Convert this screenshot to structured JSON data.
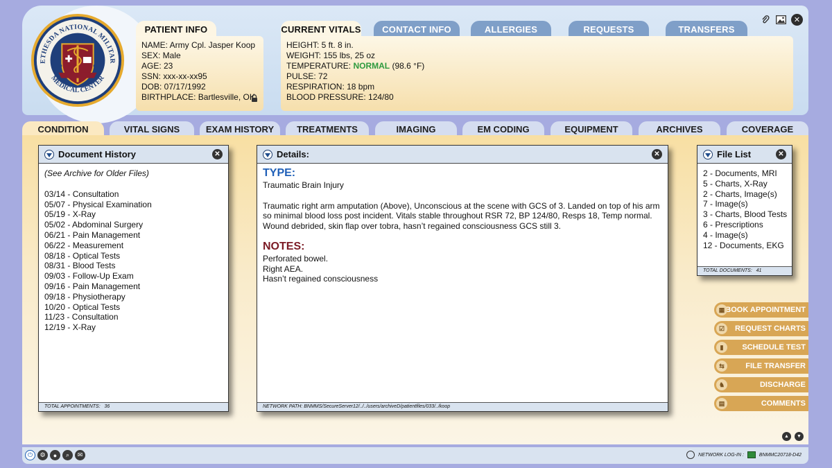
{
  "logo": {
    "text_top": "BETHESDA NATIONAL MILITARY",
    "text_bottom": "MEDICAL CENTER"
  },
  "window_icons": [
    "paperclip-icon",
    "image-icon",
    "close-icon"
  ],
  "header_tabs": {
    "patient_info": "PATIENT INFO",
    "current_vitals": "CURRENT VITALS",
    "contact_info": "CONTACT INFO",
    "allergies": "ALLERGIES",
    "requests": "REQUESTS",
    "transfers": "TRANSFERS"
  },
  "patient": {
    "name": "NAME: Army Cpl. Jasper Koop",
    "sex": "SEX: Male",
    "age": "AGE: 23",
    "ssn": "SSN: xxx-xx-xx95",
    "dob": "DOB: 07/17/1992",
    "birthplace": "BIRTHPLACE: Bartlesville, OK"
  },
  "vitals": {
    "height": "HEIGHT: 5 ft. 8 in.",
    "weight": "WEIGHT: 155 lbs, 25 oz",
    "temperature_label": "TEMPERATURE: ",
    "temperature_status": "NORMAL",
    "temperature_value": " (98.6 °F)",
    "pulse": "PULSE: 72",
    "respiration": "RESPIRATION: 18 bpm",
    "blood_pressure": "BLOOD PRESSURE: 124/80"
  },
  "main_tabs": [
    "CONDITION",
    "VITAL SIGNS",
    "EXAM HISTORY",
    "TREATMENTS",
    "IMAGING",
    "EM CODING",
    "EQUIPMENT",
    "ARCHIVES",
    "COVERAGE"
  ],
  "document_history": {
    "title": "Document History",
    "note": "(See Archive for Older Files)",
    "items": [
      "03/14 - Consultation",
      "05/07 - Physical Examination",
      "05/19 - X-Ray",
      "05/02 - Abdominal Surgery",
      "06/21 - Pain Management",
      "06/22 - Measurement",
      "08/18 - Optical Tests",
      "08/31 - Blood Tests",
      "09/03 - Follow-Up Exam",
      "09/16 - Pain Management",
      "09/18 - Physiotherapy",
      "10/20 - Optical Tests",
      "11/23 - Consultation",
      "12/19 - X-Ray"
    ],
    "footer_label": "TOTAL APPOINTMENTS:",
    "footer_value": "36"
  },
  "details": {
    "title": "Details:",
    "type_heading": "TYPE:",
    "type_value": "Traumatic Brain Injury",
    "description": "Traumatic right arm amputation (Above), Unconscious at the scene with GCS of 3. Landed on top of his arm so minimal blood loss post incident. Vitals stable throughout RSR 72, BP 124/80, Resps 18, Temp normal.  Wound debrided, skin flap over tobra, hasn’t regained consciousness GCS still 3.",
    "notes_heading": "NOTES:",
    "notes": [
      "Perforated bowel.",
      "Right AEA.",
      "Hasn’t regained consciousness"
    ],
    "footer": "NETWORK PATH: BNMMS/SecureServer12/../../users/archiveD/patientfiles/033/../koop"
  },
  "file_list": {
    "title": "File List",
    "items": [
      "2 - Documents, MRI",
      "5 - Charts, X-Ray",
      "2 - Charts, Image(s)",
      "7 - Image(s)",
      "3 - Charts, Blood Tests",
      "6 - Prescriptions",
      "4 - Image(s)",
      "12 - Documents, EKG"
    ],
    "footer_label": "TOTAL DOCUMENTS:",
    "footer_value": "41"
  },
  "actions": [
    {
      "label": "BOOK APPOINTMENT",
      "icon": "calendar-icon"
    },
    {
      "label": "REQUEST CHARTS",
      "icon": "clipboard-icon"
    },
    {
      "label": "SCHEDULE TEST",
      "icon": "thermometer-icon"
    },
    {
      "label": "FILE TRANSFER",
      "icon": "transfer-arrows-icon"
    },
    {
      "label": "DISCHARGE",
      "icon": "walking-person-icon"
    },
    {
      "label": "COMMENTS",
      "icon": "document-icon"
    }
  ],
  "statusbar": {
    "network_label": "NETWORK LOG-IN :",
    "network_id": "BNMMC20718-D42"
  },
  "colors": {
    "background": "#a6abe0",
    "header": "#dbe8f6",
    "active_tab": "#fbe9c2",
    "inactive_tab": "#d5ddf0",
    "action_button": "#d8a655",
    "type_heading": "#2060b8",
    "notes_heading": "#7b1a24",
    "normal_status": "#2e9a3f"
  }
}
